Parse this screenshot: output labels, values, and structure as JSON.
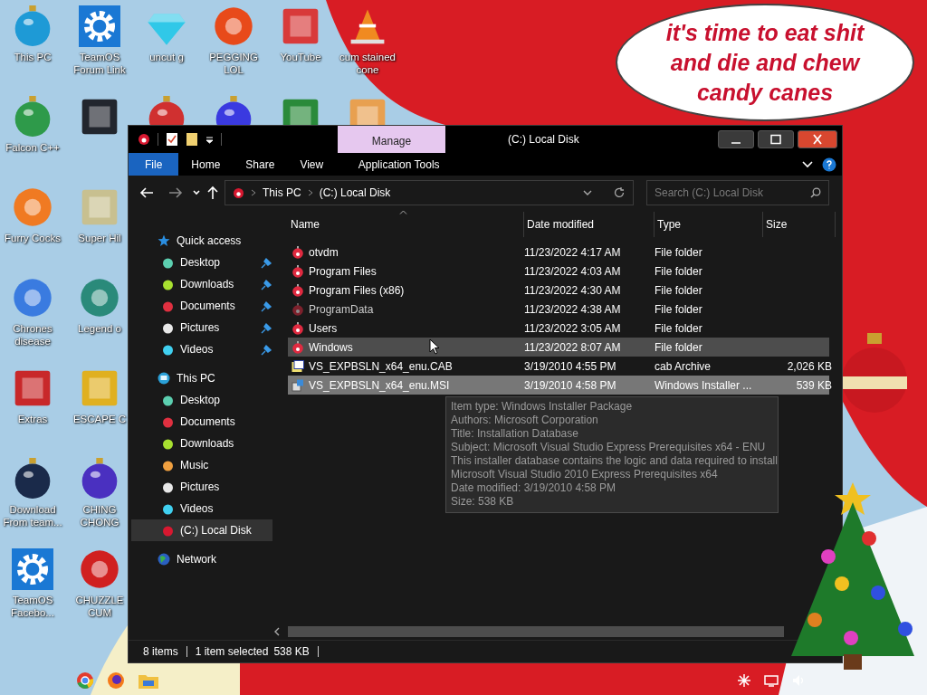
{
  "desktop": {
    "columns": [
      [
        {
          "label": "This PC",
          "kind": "ornament",
          "color": "#1e9ad6"
        },
        {
          "label": "Falcon C++",
          "kind": "ornament",
          "color": "#2e9a4a"
        },
        {
          "label": "Furry Cocks",
          "kind": "ball",
          "color": "#f07a22"
        },
        {
          "label": "Chrones disease",
          "kind": "ball",
          "color": "#3a7be0"
        },
        {
          "label": "Extras",
          "kind": "square",
          "color": "#c8282a"
        },
        {
          "label": "Download From team...",
          "kind": "ornament",
          "color": "#1a2a4a"
        },
        {
          "label": "TeamOS Facebo...",
          "kind": "gear",
          "color": "#1a78d4"
        }
      ],
      [
        {
          "label": "TeamOS Forum Link",
          "kind": "gear",
          "color": "#1a78d4"
        },
        {
          "kind": "square",
          "color": "#22262e"
        },
        {
          "label": "Super Hil",
          "kind": "square",
          "color": "#c8c090"
        },
        {
          "label": "Legend o",
          "kind": "ball",
          "color": "#2a8a7a"
        },
        {
          "label": "ESCAPE C",
          "kind": "square",
          "color": "#e0b020"
        },
        {
          "label": "CHING CHONG",
          "kind": "ornament",
          "color": "#4a30c0"
        },
        {
          "label": "CHUZZLE CUM",
          "kind": "ball",
          "color": "#d02020"
        }
      ],
      [
        {
          "label": "uncut g",
          "kind": "gem",
          "color": "#30c8e8"
        },
        {
          "kind": "ornament",
          "color": "#d03030"
        }
      ],
      [
        {
          "label": "PEGGING LOL",
          "kind": "ball",
          "color": "#e84a1a"
        },
        {
          "kind": "ornament",
          "color": "#3a3ae0"
        }
      ],
      [
        {
          "label": "YouTube",
          "kind": "square",
          "color": "#d83a3a"
        },
        {
          "kind": "square",
          "color": "#2a8a3a"
        }
      ],
      [
        {
          "label": "cum stained cone",
          "kind": "cone",
          "color": "#f08a20"
        },
        {
          "kind": "square",
          "color": "#e8a050"
        }
      ]
    ],
    "speech_bubble": {
      "lines": [
        "it's time to eat shit",
        "and die and chew",
        "candy canes"
      ]
    }
  },
  "explorer": {
    "context_tab": "Manage",
    "title": "(C:) Local Disk",
    "ribbon_tabs": [
      {
        "label": "File",
        "selected": true
      },
      {
        "label": "Home",
        "selected": false
      },
      {
        "label": "Share",
        "selected": false
      },
      {
        "label": "View",
        "selected": false
      },
      {
        "label": "Application Tools",
        "selected": false
      }
    ],
    "address": [
      "This PC",
      "(C:) Local Disk"
    ],
    "search": {
      "placeholder": "Search (C:) Local Disk"
    },
    "nav_tree": [
      {
        "label": "Quick access",
        "kind": "star",
        "selected": false,
        "children": [
          {
            "label": "Desktop",
            "color": "#5ccfb0",
            "pinned": true,
            "selected": false
          },
          {
            "label": "Downloads",
            "color": "#a8e030",
            "pinned": true,
            "selected": false
          },
          {
            "label": "Documents",
            "color": "#e03040",
            "pinned": true,
            "selected": false
          },
          {
            "label": "Pictures",
            "color": "#e8e8e8",
            "pinned": true,
            "selected": false
          },
          {
            "label": "Videos",
            "color": "#40d0f0",
            "pinned": true,
            "selected": false
          }
        ]
      },
      {
        "label": "This PC",
        "kind": "computer",
        "selected": false,
        "children": [
          {
            "label": "Desktop",
            "color": "#5ccfb0",
            "pinned": false,
            "selected": false
          },
          {
            "label": "Documents",
            "color": "#e03040",
            "pinned": false,
            "selected": false
          },
          {
            "label": "Downloads",
            "color": "#a8e030",
            "pinned": false,
            "selected": false
          },
          {
            "label": "Music",
            "color": "#f0a040",
            "pinned": false,
            "selected": false
          },
          {
            "label": "Pictures",
            "color": "#e8e8e8",
            "pinned": false,
            "selected": false
          },
          {
            "label": "Videos",
            "color": "#40d0f0",
            "pinned": false,
            "selected": false
          },
          {
            "label": "(C:) Local Disk",
            "color": "#d81830",
            "pinned": false,
            "selected": true
          }
        ]
      },
      {
        "label": "Network",
        "kind": "globe",
        "selected": false
      }
    ],
    "columns": [
      "Name",
      "Date modified",
      "Type",
      "Size"
    ],
    "rows": [
      {
        "name": "otvdm",
        "date": "11/23/2022 4:17 AM",
        "type": "File folder",
        "kind": "folder",
        "hidden": false,
        "hovered": false,
        "selected": false
      },
      {
        "name": "Program Files",
        "date": "11/23/2022 4:03 AM",
        "type": "File folder",
        "kind": "folder",
        "hidden": false,
        "hovered": false,
        "selected": false
      },
      {
        "name": "Program Files (x86)",
        "date": "11/23/2022 4:30 AM",
        "type": "File folder",
        "kind": "folder",
        "hidden": false,
        "hovered": false,
        "selected": false
      },
      {
        "name": "ProgramData",
        "date": "11/23/2022 4:38 AM",
        "type": "File folder",
        "kind": "folder",
        "hidden": true,
        "hovered": false,
        "selected": false
      },
      {
        "name": "Users",
        "date": "11/23/2022 3:05 AM",
        "type": "File folder",
        "kind": "folder",
        "hidden": false,
        "hovered": false,
        "selected": false
      },
      {
        "name": "Windows",
        "date": "11/23/2022 8:07 AM",
        "type": "File folder",
        "kind": "folder",
        "hidden": false,
        "hovered": true,
        "selected": false
      },
      {
        "name": "VS_EXPBSLN_x64_enu.CAB",
        "date": "3/19/2010 4:55 PM",
        "type": "cab Archive",
        "size": "2,026 KB",
        "kind": "cab",
        "hidden": false,
        "hovered": false,
        "selected": false
      },
      {
        "name": "VS_EXPBSLN_x64_enu.MSI",
        "date": "3/19/2010 4:58 PM",
        "type": "Windows Installer ...",
        "size": "539 KB",
        "kind": "msi",
        "hidden": false,
        "hovered": false,
        "selected": true
      }
    ],
    "tooltip": [
      "Item type: Windows Installer Package",
      "Authors: Microsoft Corporation",
      "Title: Installation Database",
      "Subject: Microsoft Visual Studio Express Prerequisites x64 - ENU",
      "This installer database contains the logic and data required to install",
      "Microsoft Visual Studio 2010 Express Prerequisites x64",
      "Date modified: 3/19/2010 4:58 PM",
      "Size: 538 KB"
    ],
    "status_bar": {
      "item_count": "8 items",
      "selection": "1 item selected",
      "selection_size": "538 KB"
    }
  }
}
